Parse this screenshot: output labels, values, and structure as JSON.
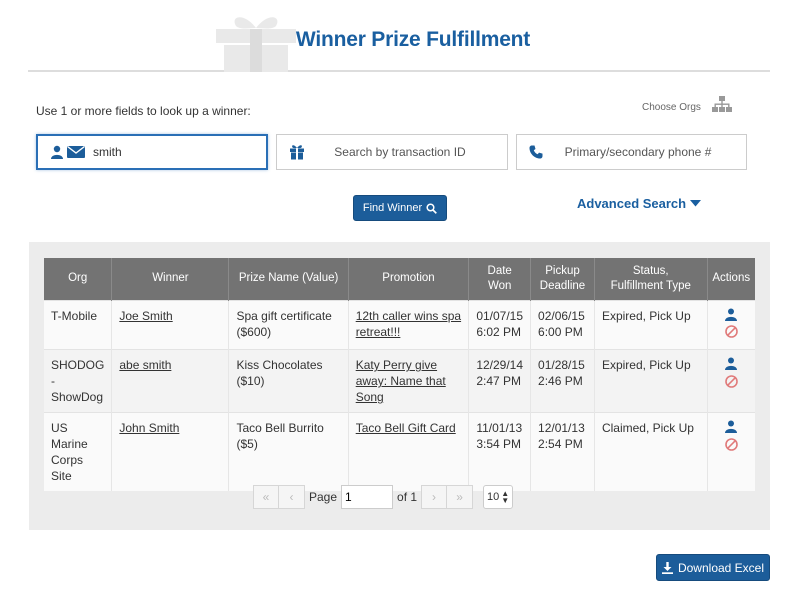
{
  "header": {
    "title": "Winner Prize Fulfillment"
  },
  "search": {
    "intro": "Use 1 or more fields to look up a winner:",
    "choose_orgs": "Choose Orgs",
    "name_value": "smith",
    "transaction_placeholder": "Search by transaction ID",
    "phone_placeholder": "Primary/secondary phone #",
    "find_label": "Find Winner",
    "advanced_label": "Advanced Search"
  },
  "table": {
    "columns": [
      "Org",
      "Winner",
      "Prize Name (Value)",
      "Promotion",
      "Date Won",
      "Pickup Deadline",
      "Status, Fulfillment Type",
      "Actions"
    ],
    "rows": [
      {
        "org": "T-Mobile",
        "winner": "Joe Smith",
        "prize": "Spa gift certificate ($600)",
        "promotion": "12th caller wins spa retreat!!!",
        "date_won": "01/07/15 6:02 PM",
        "deadline": "02/06/15 6:00 PM",
        "status": "Expired, Pick Up"
      },
      {
        "org": "SHODOG - ShowDog",
        "winner": "abe smith",
        "prize": "Kiss Chocolates ($10)",
        "promotion": "Katy Perry give away: Name that Song",
        "date_won": "12/29/14 2:47 PM",
        "deadline": "01/28/15 2:46 PM",
        "status": "Expired, Pick Up"
      },
      {
        "org": "US Marine Corps Site",
        "winner": "John Smith",
        "prize": "Taco Bell Burrito ($5)",
        "promotion": "Taco Bell Gift Card",
        "date_won": "11/01/13 3:54 PM",
        "deadline": "12/01/13 2:54 PM",
        "status": "Claimed, Pick Up"
      }
    ]
  },
  "pagination": {
    "page_label": "Page",
    "current_page": "1",
    "of_label": "of 1",
    "per_page": "10"
  },
  "download": {
    "label": "Download Excel"
  },
  "colors": {
    "brand_blue": "#1c5d9a",
    "title_blue": "#1a5fa0",
    "header_gray": "#737373",
    "cancel_red": "#e07a7a"
  }
}
